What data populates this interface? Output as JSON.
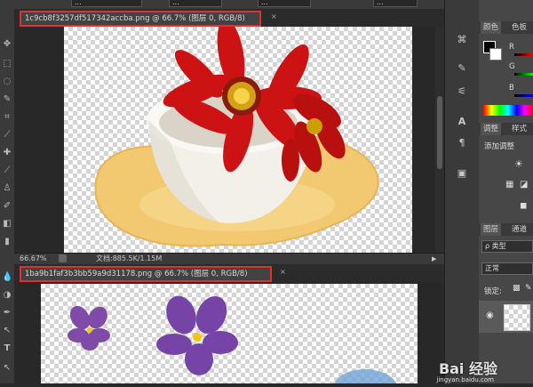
{
  "options_bar": {
    "field1": "...",
    "field2": "...",
    "field3": "...",
    "field4": "..."
  },
  "doc1": {
    "tab_title": "1c9cb8f3257df517342accba.png @ 66.7% (图层 0, RGB/8)",
    "close_glyph": "×",
    "zoom": "66.67%",
    "doc_info": "文档:885.5K/1.15M"
  },
  "doc2": {
    "tab_title": "1ba9b1faf3b3bb59a9d31178.png @ 66.7% (图层 0, RGB/8)",
    "close_glyph": "×"
  },
  "panels": {
    "color_tabs": [
      "颜色",
      "色板"
    ],
    "channels": [
      "R",
      "G",
      "B"
    ],
    "adjust_tabs": [
      "调整",
      "样式"
    ],
    "add_adjustment": "添加调整",
    "layers_tabs": [
      "图层",
      "通道"
    ],
    "kind_filter": "ρ 类型",
    "blend_mode": "正常",
    "lock_label": "锁定:"
  },
  "watermark": {
    "brand": "Bai 经验",
    "url": "jingyan.baidu.com"
  },
  "colors": {
    "highlight_border": "#e03030",
    "panel_bg": "#474747",
    "app_bg": "#282828"
  }
}
